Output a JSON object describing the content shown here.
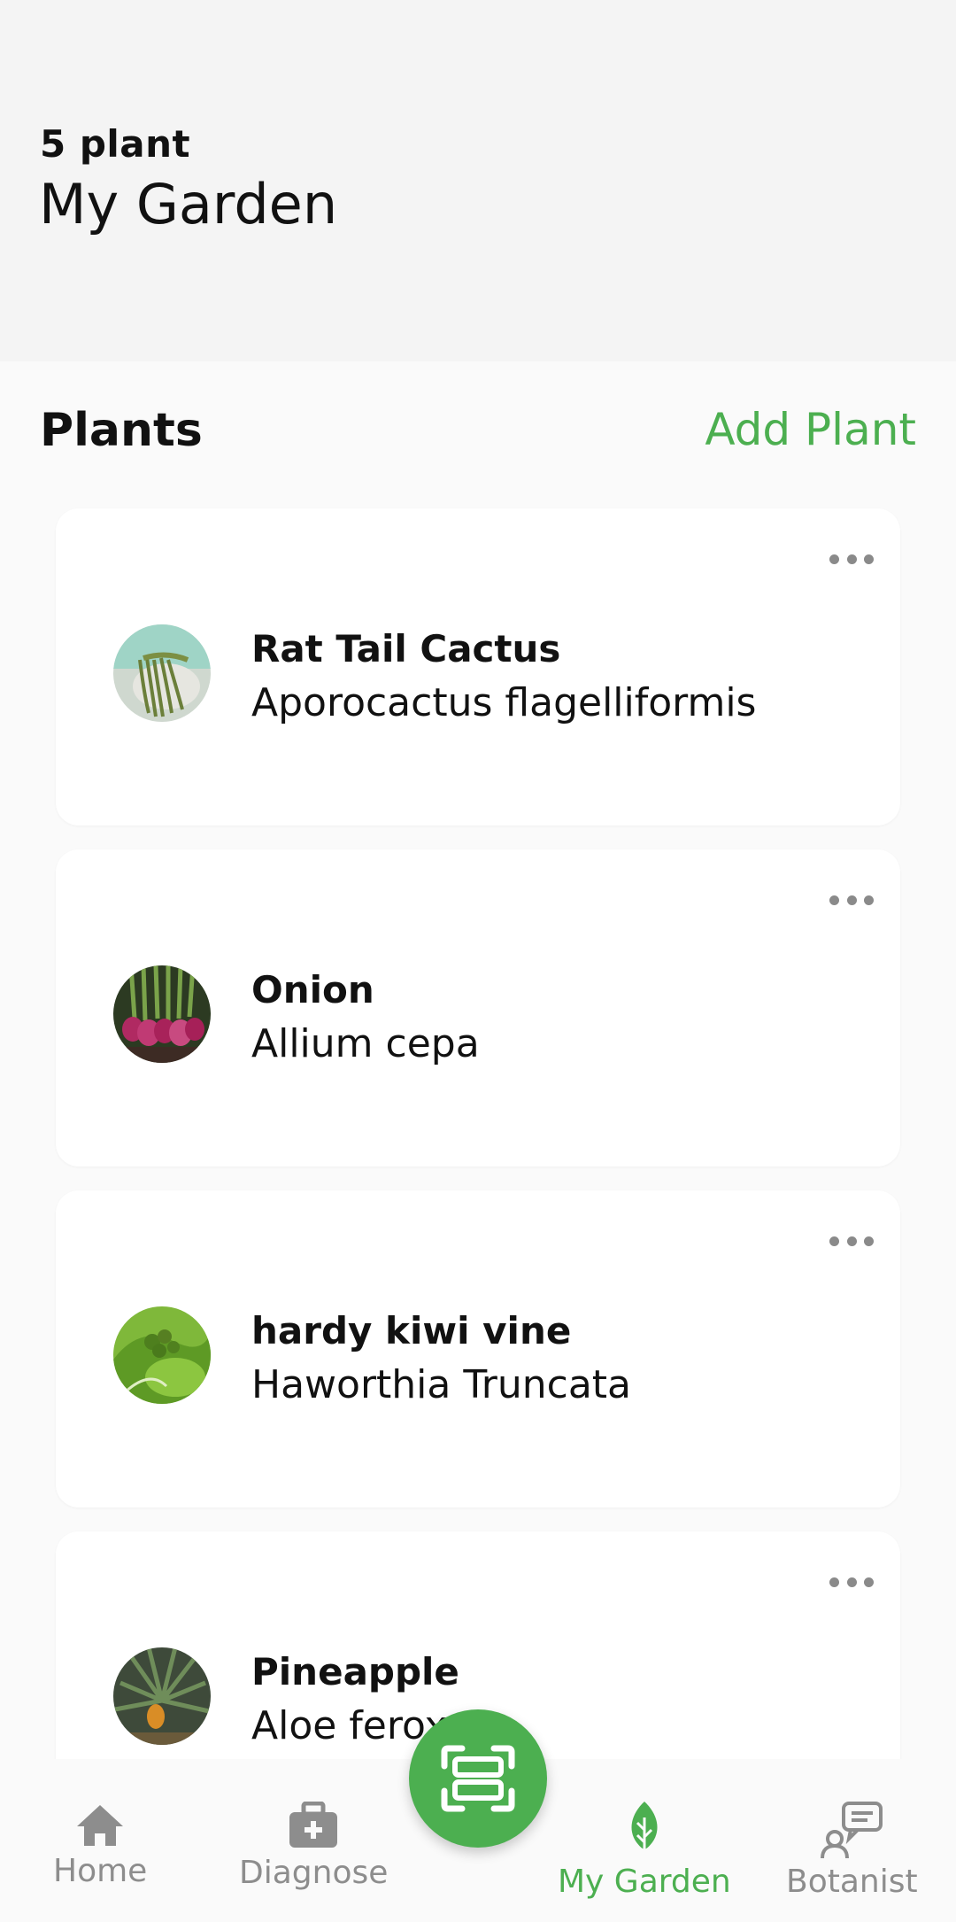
{
  "header": {
    "count": "5 plant",
    "title": "My Garden"
  },
  "section": {
    "title": "Plants",
    "add_label": "Add Plant"
  },
  "plants": [
    {
      "name": "Rat Tail Cactus",
      "scientific": "Aporocactus flagelliformis"
    },
    {
      "name": "Onion",
      "scientific": "Allium cepa"
    },
    {
      "name": "hardy kiwi vine",
      "scientific": "Haworthia Truncata"
    },
    {
      "name": "Pineapple",
      "scientific": "Aloe ferox"
    }
  ],
  "nav": {
    "home": "Home",
    "diagnose": "Diagnose",
    "my_garden": "My Garden",
    "botanist": "Botanist"
  },
  "colors": {
    "accent": "#4caf50",
    "icon_gray": "#8d8d8d"
  },
  "icons": {
    "home": "home-icon",
    "diagnose": "first-aid-kit-icon",
    "scan": "scan-icon",
    "garden": "leaf-icon",
    "botanist": "chat-person-icon",
    "more": "more-horizontal-icon"
  }
}
